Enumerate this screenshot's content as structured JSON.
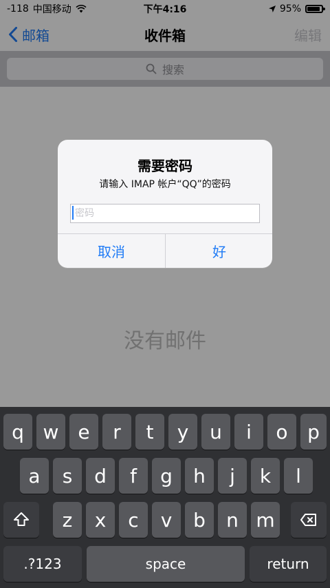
{
  "status": {
    "signal": "-118",
    "carrier": "中国移动",
    "time": "下午4:16",
    "battery": "95%"
  },
  "nav": {
    "back_label": "邮箱",
    "title": "收件箱",
    "edit_label": "编辑"
  },
  "search": {
    "placeholder": "搜索"
  },
  "empty_text": "没有邮件",
  "alert": {
    "title": "需要密码",
    "message": "请输入 IMAP 帐户“QQ”的密码",
    "input_placeholder": "密码",
    "cancel_label": "取消",
    "ok_label": "好"
  },
  "keyboard": {
    "row1": [
      "q",
      "w",
      "e",
      "r",
      "t",
      "y",
      "u",
      "i",
      "o",
      "p"
    ],
    "row2": [
      "a",
      "s",
      "d",
      "f",
      "g",
      "h",
      "j",
      "k",
      "l"
    ],
    "row3": [
      "z",
      "x",
      "c",
      "v",
      "b",
      "n",
      "m"
    ],
    "numbers_label": ".?123",
    "space_label": "space",
    "return_label": "return"
  },
  "colors": {
    "accent": "#1f7bf6",
    "keyboard_bg": "#2f3033",
    "key_bg": "#57585c"
  },
  "icons": {
    "back": "chevron-left-icon",
    "search": "search-icon",
    "wifi": "wifi-icon",
    "location": "location-arrow-icon",
    "battery": "battery-icon",
    "shift": "shift-icon",
    "delete": "backspace-icon"
  }
}
